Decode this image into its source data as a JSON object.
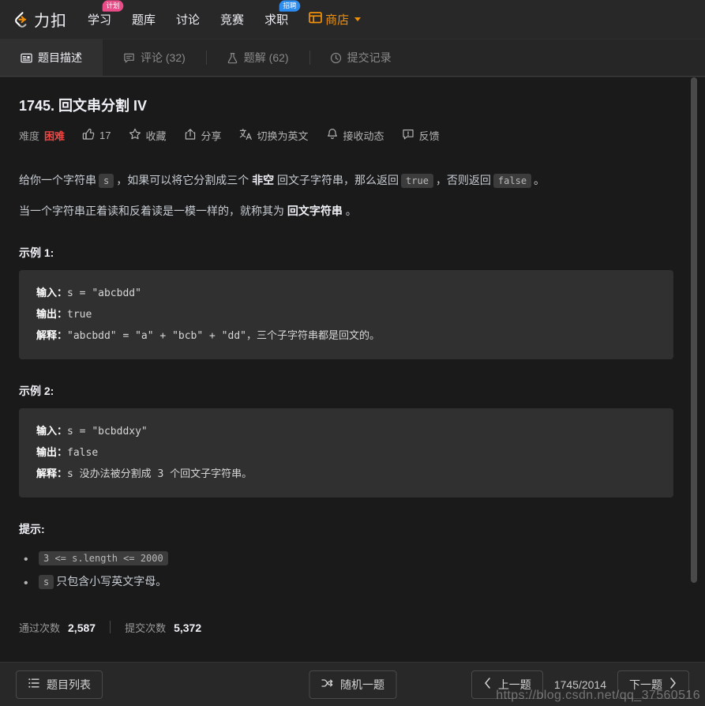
{
  "navbar": {
    "logo_text": "力扣",
    "items": [
      {
        "label": "学习",
        "badge": "计划",
        "badge_color": "#ea4c89"
      },
      {
        "label": "题库",
        "badge": null
      },
      {
        "label": "讨论",
        "badge": null
      },
      {
        "label": "竞赛",
        "badge": null
      },
      {
        "label": "求职",
        "badge": "招聘",
        "badge_color": "#2d8cf0"
      },
      {
        "label": "商店",
        "badge": null,
        "accent": "#f0900b"
      }
    ]
  },
  "tabs": [
    {
      "label": "题目描述",
      "icon": "description-icon",
      "active": true
    },
    {
      "label": "评论 (32)",
      "icon": "comment-icon",
      "active": false
    },
    {
      "label": "题解 (62)",
      "icon": "flask-icon",
      "active": false
    },
    {
      "label": "提交记录",
      "icon": "clock-icon",
      "active": false
    }
  ],
  "problem": {
    "title": "1745. 回文串分割 IV",
    "difficulty_label": "难度",
    "difficulty_value": "困难",
    "difficulty_color": "#ef4743",
    "likes": "17",
    "favorite_label": "收藏",
    "share_label": "分享",
    "translate_label": "切换为英文",
    "subscribe_label": "接收动态",
    "feedback_label": "反馈",
    "description_p1": {
      "t1": "给你一个字符串",
      "c1": "s",
      "t2": "，如果可以将它分割成三个",
      "b1": "非空",
      "t3": "回文子字符串，那么返回",
      "c2": "true",
      "t4": "，否则返回",
      "c3": "false",
      "t5": "。"
    },
    "description_p2": {
      "t1": "当一个字符串正着读和反着读是一模一样的，就称其为",
      "b1": "回文字符串",
      "t2": "。"
    },
    "examples": [
      {
        "heading": "示例 1:",
        "input_key": "输入：",
        "input_value": "s = \"abcbdd\"",
        "output_key": "输出：",
        "output_value": "true",
        "explain_key": "解释：",
        "explain_value": "\"abcbdd\" = \"a\" + \"bcb\" + \"dd\"，三个子字符串都是回文的。"
      },
      {
        "heading": "示例 2:",
        "input_key": "输入：",
        "input_value": "s = \"bcbddxy\"",
        "output_key": "输出：",
        "output_value": "false",
        "explain_key": "解释：",
        "explain_value": "s 没办法被分割成 3 个回文子字符串。"
      }
    ],
    "hints_heading": "提示:",
    "hints": [
      {
        "code": "3 <= s.length <= 2000",
        "text": ""
      },
      {
        "code": "s",
        "text": "只包含小写英文字母。"
      }
    ],
    "stats": {
      "accepted_label": "通过次数",
      "accepted_value": "2,587",
      "submissions_label": "提交次数",
      "submissions_value": "5,372"
    }
  },
  "footer": {
    "list_label": "题目列表",
    "random_label": "随机一题",
    "prev_label": "上一题",
    "page_indicator": "1745/2014",
    "next_label": "下一题"
  },
  "watermark": "https://blog.csdn.net/qq_37560516"
}
